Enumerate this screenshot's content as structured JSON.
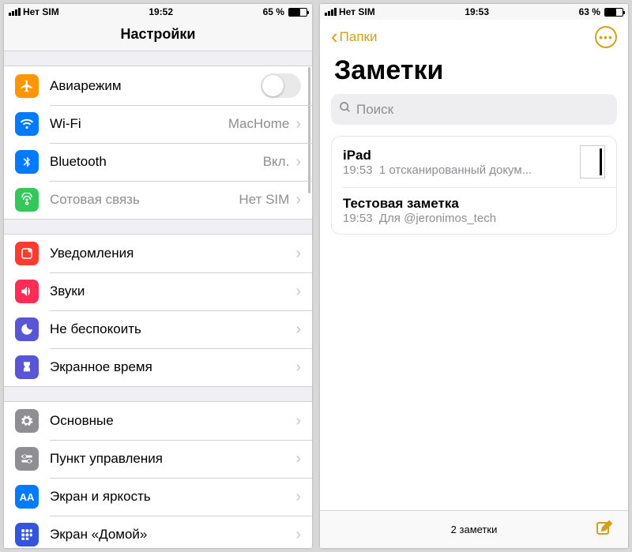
{
  "settings": {
    "status": {
      "carrier": "Нет SIM",
      "time": "19:52",
      "battery_pct": "65 %",
      "battery_fill": 65
    },
    "title": "Настройки",
    "group1": [
      {
        "key": "airplane",
        "label": "Авиарежим",
        "icon_bg": "#ff9500",
        "control": "switch"
      },
      {
        "key": "wifi",
        "label": "Wi-Fi",
        "value": "MacHome",
        "icon_bg": "#007aff",
        "control": "disclosure"
      },
      {
        "key": "bluetooth",
        "label": "Bluetooth",
        "value": "Вкл.",
        "icon_bg": "#007aff",
        "control": "disclosure"
      },
      {
        "key": "cellular",
        "label": "Сотовая связь",
        "value": "Нет SIM",
        "icon_bg": "#34c759",
        "control": "disclosure",
        "disabled": true
      }
    ],
    "group2": [
      {
        "key": "notifications",
        "label": "Уведомления",
        "icon_bg": "#ff3b30"
      },
      {
        "key": "sounds",
        "label": "Звуки",
        "icon_bg": "#ff2d55"
      },
      {
        "key": "dnd",
        "label": "Не беспокоить",
        "icon_bg": "#5856d6"
      },
      {
        "key": "screentime",
        "label": "Экранное время",
        "icon_bg": "#5856d6"
      }
    ],
    "group3": [
      {
        "key": "general",
        "label": "Основные",
        "icon_bg": "#8e8e93"
      },
      {
        "key": "controlcenter",
        "label": "Пункт управления",
        "icon_bg": "#8e8e93"
      },
      {
        "key": "display",
        "label": "Экран и яркость",
        "icon_bg": "#007aff"
      },
      {
        "key": "homescreen",
        "label": "Экран «Домой»",
        "icon_bg": "#3355dd"
      }
    ]
  },
  "notes": {
    "status": {
      "carrier": "Нет SIM",
      "time": "19:53",
      "battery_pct": "63 %",
      "battery_fill": 63
    },
    "back_label": "Папки",
    "title": "Заметки",
    "search_placeholder": "Поиск",
    "items": [
      {
        "title": "iPad",
        "time": "19:53",
        "subtitle": "1 отсканированный докум...",
        "has_thumb": true
      },
      {
        "title": "Тестовая заметка",
        "time": "19:53",
        "subtitle": "Для @jeronimos_tech",
        "has_thumb": false
      }
    ],
    "footer_count": "2 заметки"
  }
}
